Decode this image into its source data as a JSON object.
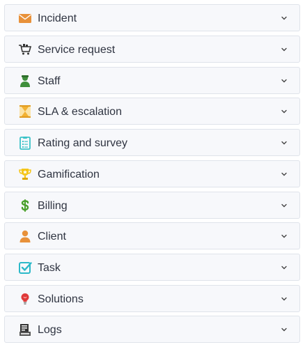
{
  "accordion": {
    "items": [
      {
        "label": "Incident",
        "icon": "envelope-icon",
        "color": "#e8913a"
      },
      {
        "label": "Service request",
        "icon": "cart-icon",
        "color": "#333333"
      },
      {
        "label": "Staff",
        "icon": "staff-person-icon",
        "color": "#3f8f3b"
      },
      {
        "label": "SLA & escalation",
        "icon": "hourglass-icon",
        "color": "#f2b233"
      },
      {
        "label": "Rating and survey",
        "icon": "clipboard-icon",
        "color": "#3cc3c8"
      },
      {
        "label": "Gamification",
        "icon": "trophy-icon",
        "color": "#f5c518"
      },
      {
        "label": "Billing",
        "icon": "dollar-icon",
        "color": "#4aa02c"
      },
      {
        "label": "Client",
        "icon": "client-person-icon",
        "color": "#e8913a"
      },
      {
        "label": "Task",
        "icon": "checkbox-icon",
        "color": "#2cb9c9"
      },
      {
        "label": "Solutions",
        "icon": "lightbulb-icon",
        "color": "#e03a3a"
      },
      {
        "label": "Logs",
        "icon": "logs-icon",
        "color": "#333333"
      }
    ]
  }
}
